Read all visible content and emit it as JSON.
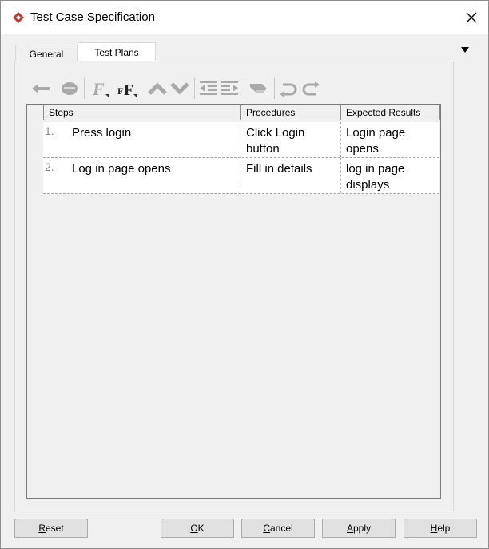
{
  "window": {
    "title": "Test Case Specification",
    "close_icon": "close-icon",
    "app_icon": "app-logo-icon"
  },
  "tabs": [
    {
      "label": "General",
      "active": false
    },
    {
      "label": "Test Plans",
      "active": true
    }
  ],
  "tab_menu_icon": "dropdown-triangle-icon",
  "toolbar": {
    "icons": [
      "back-arrow-icon",
      "remove-icon",
      "font-icon",
      "font-size-icon",
      "move-up-icon",
      "move-down-icon",
      "outdent-icon",
      "indent-icon",
      "eraser-icon",
      "undo-icon",
      "redo-icon"
    ]
  },
  "table": {
    "columns": [
      "Steps",
      "Procedures",
      "Expected Results"
    ],
    "rows": [
      {
        "num": "1.",
        "step": "Press login",
        "procedure": "Click Login button",
        "expected": "Login page opens"
      },
      {
        "num": "2.",
        "step": "Log in page opens",
        "procedure": "Fill in details",
        "expected": "log in page displays"
      }
    ]
  },
  "buttons": {
    "reset": {
      "mnemonic": "R",
      "rest": "eset"
    },
    "ok": {
      "mnemonic": "O",
      "rest": "K"
    },
    "cancel": {
      "mnemonic": "C",
      "rest": "ancel"
    },
    "apply": {
      "mnemonic": "A",
      "rest": "pply"
    },
    "help": {
      "mnemonic": "H",
      "rest": "elp"
    }
  }
}
